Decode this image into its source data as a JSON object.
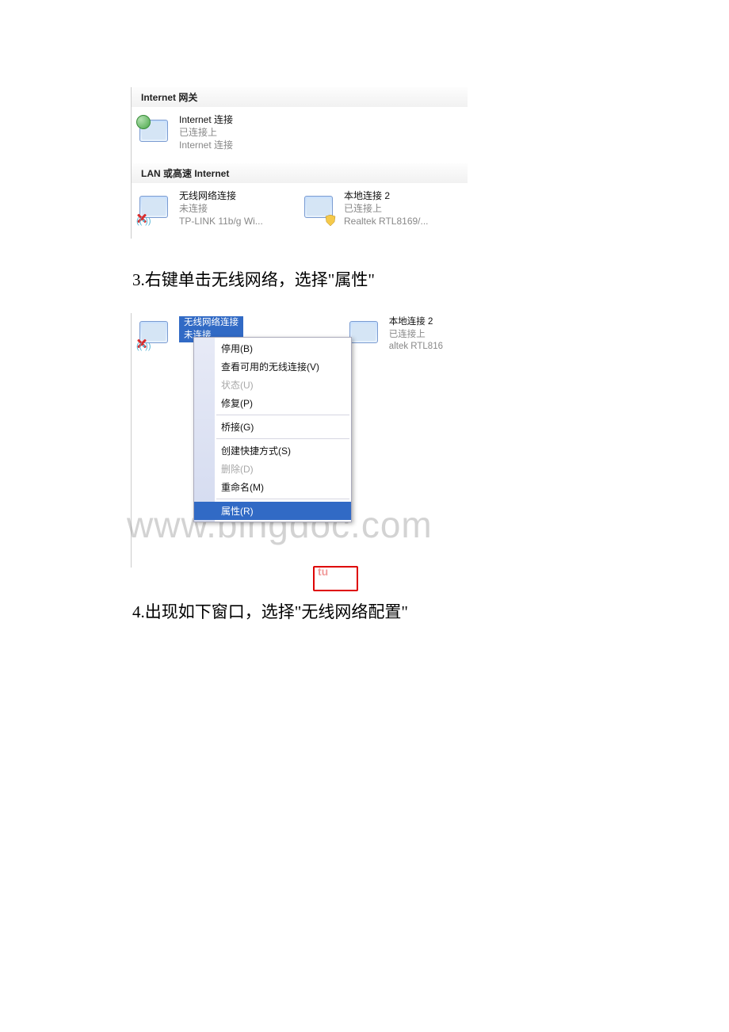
{
  "sections": {
    "gateway_header": "Internet 网关",
    "gateway_item": {
      "title": "Internet 连接",
      "status": "已连接上",
      "desc": "Internet 连接"
    },
    "lan_header": "LAN 或高速 Internet",
    "lan_items": [
      {
        "title": "无线网络连接",
        "status": "未连接",
        "desc": "TP-LINK 11b/g Wi..."
      },
      {
        "title": "本地连接 2",
        "status": "已连接上",
        "desc": "Realtek RTL8169/..."
      }
    ]
  },
  "instruction_3": "3.右键单击无线网络，选择\"属性\"",
  "instruction_4": "4.出现如下窗口，选择\"无线网络配置\"",
  "panel2": {
    "sel_title": "无线网络连接",
    "sel_status": "未连接",
    "sel_extra": "...",
    "right_title": "本地连接 2",
    "right_status": "已连接上",
    "right_desc": "altek RTL816"
  },
  "context_menu": [
    {
      "label": "停用(B)",
      "disabled": false
    },
    {
      "label": "查看可用的无线连接(V)",
      "disabled": false
    },
    {
      "label": "状态(U)",
      "disabled": true
    },
    {
      "label": "修复(P)",
      "disabled": false
    },
    {
      "sep": true
    },
    {
      "label": "桥接(G)",
      "disabled": false
    },
    {
      "sep": true
    },
    {
      "label": "创建快捷方式(S)",
      "disabled": false
    },
    {
      "label": "删除(D)",
      "disabled": true
    },
    {
      "label": "重命名(M)",
      "disabled": false
    },
    {
      "sep": true
    },
    {
      "label": "属性(R)",
      "selected": true
    }
  ],
  "watermark": "www.bingdoc.com",
  "red_box_text": "tu",
  "wifi_symbol": "((•))"
}
